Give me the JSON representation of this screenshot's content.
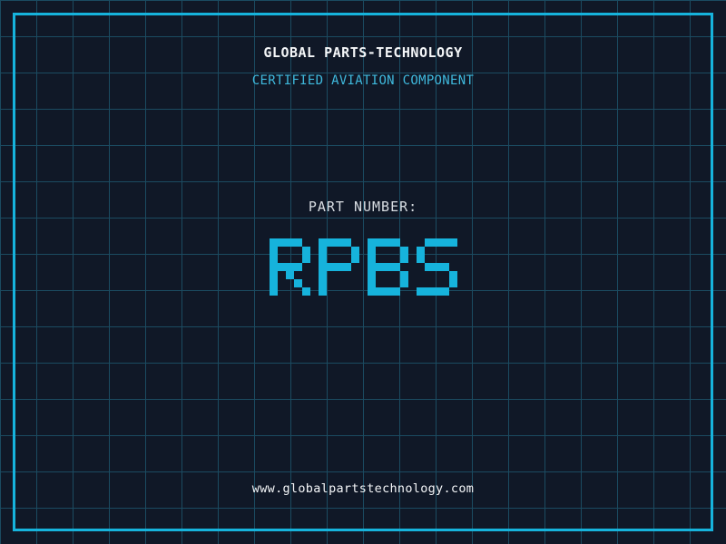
{
  "header": {
    "title": "GLOBAL PARTS-TECHNOLOGY",
    "subtitle": "CERTIFIED AVIATION COMPONENT"
  },
  "part_number": {
    "label": "PART NUMBER:",
    "value": "RPBS"
  },
  "footer": {
    "website": "www.globalpartstechnology.com"
  },
  "colors": {
    "background": "#101827",
    "grid_line": "#1b4b61",
    "accent_cyan": "#16b3dc",
    "subtitle_cyan": "#3fb9dd",
    "text_white": "#f4f6f8",
    "label_grey": "#d8dde2"
  }
}
